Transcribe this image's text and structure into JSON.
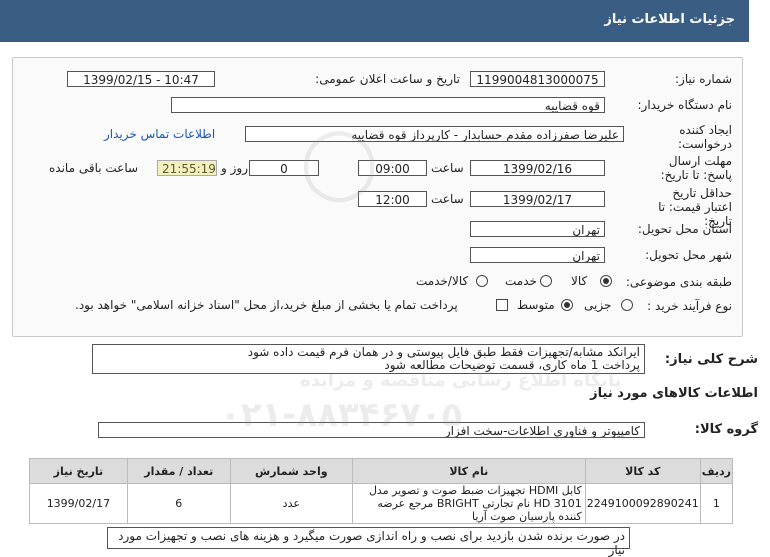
{
  "header": {
    "title": "جزئیات اطلاعات نیاز"
  },
  "form": {
    "need_number_label": "شماره نیاز:",
    "need_number": "1199004813000075",
    "announce_label": "تاریخ و ساعت اعلان عمومی:",
    "announce_value": "1399/02/15 - 10:47",
    "buyer_label": "نام دستگاه خریدار:",
    "buyer_value": "قوه قضاییه",
    "requester_label": "ایجاد کننده درخواست:",
    "requester_value": "علیرضا  صفرزاده مقدم  حسابدار - کارپرداز قوه قضاییه",
    "contact_link": "اطلاعات تماس خریدار",
    "deadline_label": "مهلت ارسال پاسخ: تا تاریخ:",
    "deadline_date": "1399/02/16",
    "time_label": "ساعت",
    "deadline_time": "09:00",
    "days_value": "0",
    "days_label": "روز و",
    "timer_value": "21:55:19",
    "remaining_label": "ساعت باقی مانده",
    "validity_label": "حداقل تاریخ اعتبار قیمت: تا تاریخ:",
    "validity_date": "1399/02/17",
    "validity_time": "12:00",
    "province_label": "استان محل تحویل:",
    "province_value": "تهران",
    "city_label": "شهر محل تحویل:",
    "city_value": "تهران",
    "category_label": "طبقه بندی موضوعی:",
    "category_options": [
      "کالا",
      "خدمت",
      "کالا/خدمت"
    ],
    "category_selected": "کالا",
    "process_label": "نوع فرآیند خرید :",
    "process_options": [
      "جزیی",
      "متوسط"
    ],
    "process_selected": "متوسط",
    "payment_text": "پرداخت تمام یا بخشی از مبلغ خرید،از محل \"اسناد خزانه اسلامی\" خواهد بود."
  },
  "description": {
    "label": "شرح کلی نیاز:",
    "line1": "ایرانکد مشابه/تجهیزات فقط طبق فایل پیوستی و در همان فرم قیمت داده شود",
    "line2": "پرداخت 1 ماه کاری، قسمت توضیحات مطالعه شود"
  },
  "goods": {
    "section_title": "اطلاعات کالاهای مورد نیاز",
    "group_label": "گروه کالا:",
    "group_value": "کامپیوتر و فناوری اطلاعات-سخت افزار",
    "columns": [
      "ردیف",
      "کد کالا",
      "نام کالا",
      "واحد شمارش",
      "تعداد / مقدار",
      "تاریخ نیاز"
    ],
    "rows": [
      {
        "row": "1",
        "code": "2249100092890241",
        "name": "کابل HDMI تجهیزات ضبط صوت و تصویر مدل HD 3101 نام تجارتی BRIGHT مرجع عرضه کننده پارسیان صوت آریا",
        "unit": "عدد",
        "qty": "6",
        "date": "1399/02/17"
      }
    ]
  },
  "notes": {
    "text": "در صورت برنده شدن بازدید برای نصب و راه اندازی صورت میگیرد و هزینه های نصب و تجهیزات مورد نیاز"
  },
  "watermark": {
    "line1": "پایگاه اطلاع رسانی مناقصه و مزایده",
    "line2": "۰۲۱-۸۸۳۴۶۷۰۵"
  },
  "colors": {
    "header_bg": "#3a5e83",
    "timer_bg": "#f3f0bf",
    "link": "#1a56b8"
  }
}
